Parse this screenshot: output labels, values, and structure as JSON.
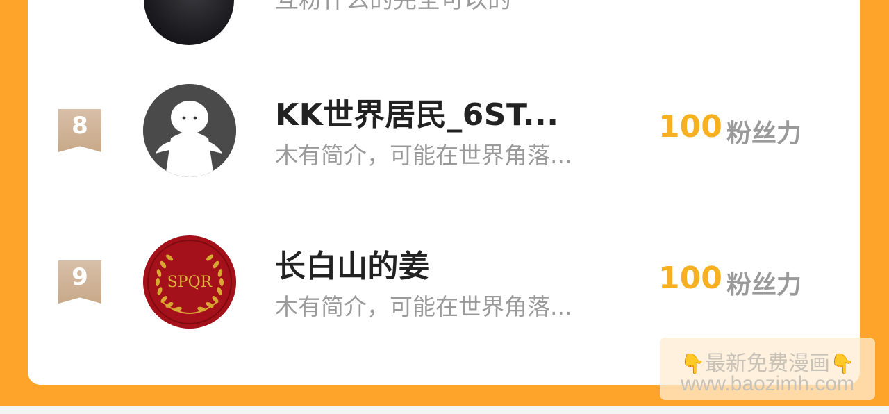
{
  "partial_row": {
    "description": "互粉什么的完全可以的"
  },
  "rows": [
    {
      "rank": "8",
      "name": "KK世界居民_6ST...",
      "description": "木有简介，可能在世界角落...",
      "fans_value": "100",
      "fans_label": "粉丝力",
      "avatar_icon": "default-user-avatar-icon"
    },
    {
      "rank": "9",
      "name": "长白山的姜",
      "description": "木有简介，可能在世界角落...",
      "fans_value": "100",
      "fans_label": "粉丝力",
      "avatar_icon": "spqr-laurel-avatar",
      "avatar_text": "SPQR"
    }
  ],
  "watermark": {
    "line1": "最新免费漫画",
    "line2": "www.baozimh.com",
    "hand_icon": "pointing-down-hand-icon"
  },
  "colors": {
    "frame": "#ffa42a",
    "fans_value": "#f6b020",
    "rank_badge": "#cfb296",
    "name": "#222222",
    "muted": "#9a9a9a"
  }
}
